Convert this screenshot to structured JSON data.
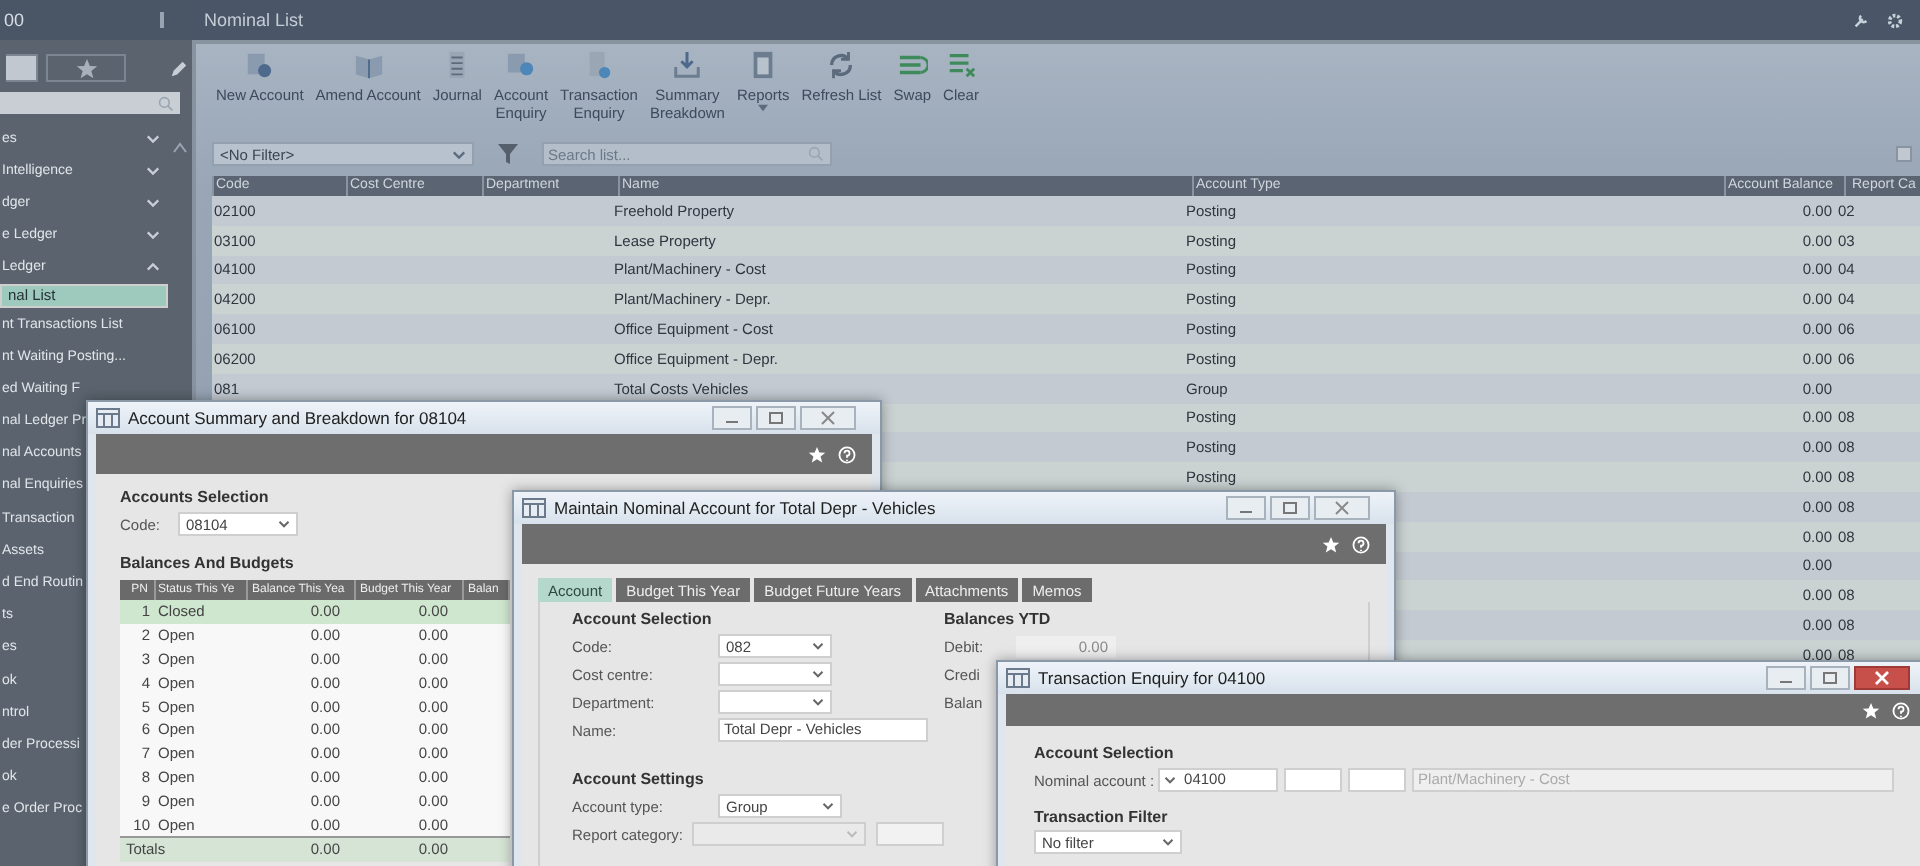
{
  "app": {
    "title": "00"
  },
  "header": {
    "title": "Nominal List"
  },
  "sidebar": {
    "tabs": [
      {
        "kind": "blank",
        "selected": true
      },
      {
        "kind": "star",
        "selected": false
      }
    ],
    "items": [
      {
        "label": "es",
        "kind": "group",
        "expanded": false
      },
      {
        "label": "Intelligence",
        "kind": "group",
        "expanded": false
      },
      {
        "label": "dger",
        "kind": "group",
        "expanded": false
      },
      {
        "label": "e Ledger",
        "kind": "group",
        "expanded": false
      },
      {
        "label": "Ledger",
        "kind": "group",
        "expanded": true
      },
      {
        "label": "nal List",
        "kind": "link",
        "selected": true
      },
      {
        "label": "nt Transactions List",
        "kind": "link",
        "selected": false
      },
      {
        "label": "nt Waiting Posting...",
        "kind": "link",
        "selected": false
      },
      {
        "label": "ed Waiting F",
        "kind": "link",
        "selected": false
      },
      {
        "label": "nal Ledger Pr",
        "kind": "link",
        "selected": false
      },
      {
        "label": "nal Accounts",
        "kind": "link",
        "selected": false
      },
      {
        "label": "nal Enquiries",
        "kind": "link",
        "selected": false
      },
      {
        "label": "Transaction",
        "kind": "link",
        "selected": false
      },
      {
        "label": "Assets",
        "kind": "link",
        "selected": false
      },
      {
        "label": "d End Routin",
        "kind": "link",
        "selected": false
      },
      {
        "label": "ts",
        "kind": "link",
        "selected": false
      },
      {
        "label": "es",
        "kind": "link",
        "selected": false
      },
      {
        "label": "ok",
        "kind": "link",
        "selected": false
      },
      {
        "label": "ntrol",
        "kind": "link",
        "selected": false
      },
      {
        "label": "der Processi",
        "kind": "link",
        "selected": false
      },
      {
        "label": "ok",
        "kind": "link",
        "selected": false
      },
      {
        "label": "e Order Proc",
        "kind": "link",
        "selected": false
      }
    ]
  },
  "toolbar": [
    {
      "lines": [
        "New Account"
      ]
    },
    {
      "lines": [
        "Amend Account"
      ]
    },
    {
      "lines": [
        "Journal"
      ]
    },
    {
      "lines": [
        "Account",
        "Enquiry"
      ]
    },
    {
      "lines": [
        "Transaction",
        "Enquiry"
      ]
    },
    {
      "lines": [
        "Summary",
        "Breakdown"
      ]
    },
    {
      "lines": [
        "Reports"
      ],
      "menu": true
    },
    {
      "lines": [
        "Refresh List"
      ]
    },
    {
      "lines": [
        "Swap"
      ]
    },
    {
      "lines": [
        "Clear"
      ]
    }
  ],
  "filter": {
    "value": "<No Filter>"
  },
  "search": {
    "placeholder": "Search list..."
  },
  "table": {
    "columns": [
      "Code",
      "Cost Centre",
      "Department",
      "Name",
      "Account Type",
      "Account Balance",
      "Report Ca"
    ],
    "rows": [
      {
        "code": "02100",
        "name": "Freehold Property",
        "type": "Posting",
        "balance": "0.00",
        "report": "02"
      },
      {
        "code": "03100",
        "name": "Lease Property",
        "type": "Posting",
        "balance": "0.00",
        "report": "03"
      },
      {
        "code": "04100",
        "name": "Plant/Machinery - Cost",
        "type": "Posting",
        "balance": "0.00",
        "report": "04"
      },
      {
        "code": "04200",
        "name": "Plant/Machinery - Depr.",
        "type": "Posting",
        "balance": "0.00",
        "report": "04"
      },
      {
        "code": "06100",
        "name": "Office Equipment - Cost",
        "type": "Posting",
        "balance": "0.00",
        "report": "06"
      },
      {
        "code": "06200",
        "name": "Office Equipment - Depr.",
        "type": "Posting",
        "balance": "0.00",
        "report": "06"
      },
      {
        "code": "081",
        "name": "Total Costs Vehicles",
        "type": "Group",
        "balance": "0.00"
      },
      {
        "type": "Posting",
        "balance": "0.00",
        "report": "08"
      },
      {
        "type": "Posting",
        "balance": "0.00",
        "report": "08"
      },
      {
        "type": "Posting",
        "balance": "0.00",
        "report": "08"
      },
      {
        "balance": "0.00",
        "report": "08"
      },
      {
        "balance": "0.00",
        "report": "08"
      },
      {
        "balance": "0.00"
      },
      {
        "balance": "0.00",
        "report": "08"
      },
      {
        "balance": "0.00",
        "report": "08"
      },
      {
        "balance": "0.00",
        "report": "08"
      }
    ]
  },
  "summary_window": {
    "title": "Account Summary and Breakdown for 08104",
    "section": "Accounts Selection",
    "code_label": "Code:",
    "code": "08104",
    "grid_title": "Balances And Budgets",
    "columns": [
      "PN",
      "Status This Ye",
      "Balance This Yea",
      "Budget This Year",
      "Balan"
    ],
    "rows": [
      {
        "pn": "1",
        "status": "Closed",
        "balance": "0.00",
        "budget": "0.00",
        "selected": true
      },
      {
        "pn": "2",
        "status": "Open",
        "balance": "0.00",
        "budget": "0.00",
        "selected": false
      },
      {
        "pn": "3",
        "status": "Open",
        "balance": "0.00",
        "budget": "0.00",
        "selected": false
      },
      {
        "pn": "4",
        "status": "Open",
        "balance": "0.00",
        "budget": "0.00",
        "selected": false
      },
      {
        "pn": "5",
        "status": "Open",
        "balance": "0.00",
        "budget": "0.00",
        "selected": false
      },
      {
        "pn": "6",
        "status": "Open",
        "balance": "0.00",
        "budget": "0.00",
        "selected": false
      },
      {
        "pn": "7",
        "status": "Open",
        "balance": "0.00",
        "budget": "0.00",
        "selected": false
      },
      {
        "pn": "8",
        "status": "Open",
        "balance": "0.00",
        "budget": "0.00",
        "selected": false
      },
      {
        "pn": "9",
        "status": "Open",
        "balance": "0.00",
        "budget": "0.00",
        "selected": false
      },
      {
        "pn": "10",
        "status": "Open",
        "balance": "0.00",
        "budget": "0.00",
        "selected": false
      }
    ],
    "totals": {
      "label": "Totals",
      "balance": "0.00",
      "budget": "0.00"
    }
  },
  "maintain_window": {
    "title": "Maintain Nominal Account for Total Depr - Vehicles",
    "tabs": [
      {
        "label": "Account",
        "selected": true
      },
      {
        "label": "Budget This Year",
        "selected": false
      },
      {
        "label": "Budget Future Years",
        "selected": false
      },
      {
        "label": "Attachments",
        "selected": false
      },
      {
        "label": "Memos",
        "selected": false
      }
    ],
    "left_section": "Account Selection",
    "fields": [
      {
        "label": "Code:",
        "kind": "select",
        "value": "082"
      },
      {
        "label": "Cost centre:",
        "kind": "select"
      },
      {
        "label": "Department:",
        "kind": "select"
      },
      {
        "label": "Name:",
        "kind": "text",
        "value": "Total Depr - Vehicles"
      }
    ],
    "settings_section": "Account Settings",
    "settings": [
      {
        "label": "Account type:",
        "kind": "select",
        "value": "Group"
      },
      {
        "label": "Report category:",
        "kind": "disabled"
      }
    ],
    "right_section": "Balances YTD",
    "balances": [
      {
        "label": "Debit:",
        "value": "0.00"
      },
      {
        "label": "Credi"
      },
      {
        "label": "Balan"
      }
    ]
  },
  "enquiry_window": {
    "title": "Transaction Enquiry for 04100",
    "section": "Account Selection",
    "account_label": "Nominal account :",
    "account": "04100",
    "account_name": "Plant/Machinery - Cost",
    "filter_section": "Transaction Filter",
    "filter": "No filter"
  }
}
